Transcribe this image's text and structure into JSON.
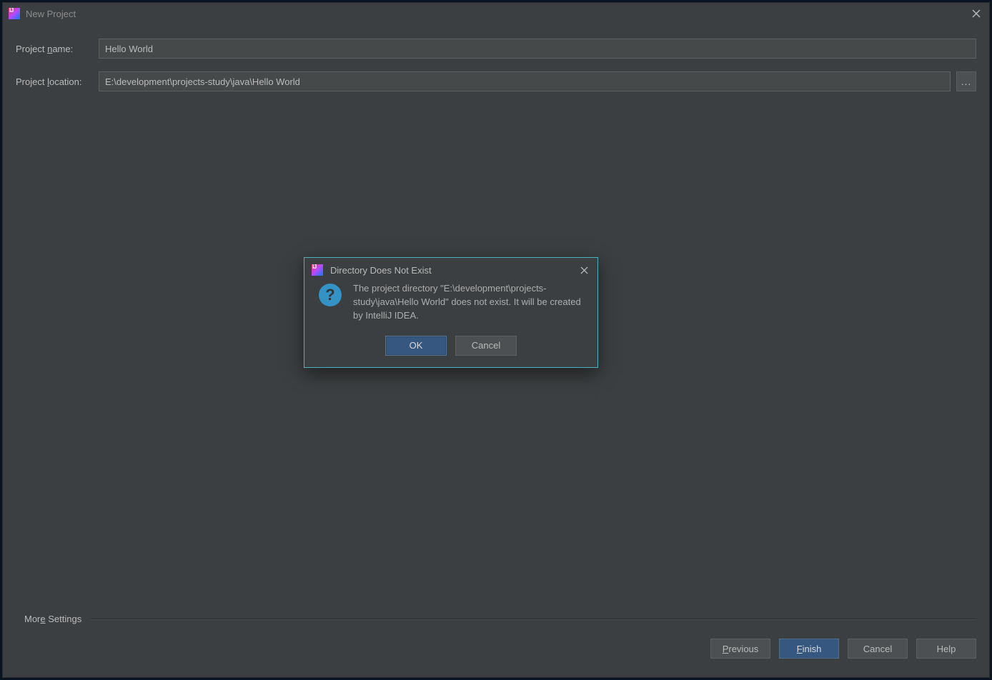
{
  "window": {
    "title": "New Project"
  },
  "form": {
    "project_name_label_pre": "Project ",
    "project_name_label_u": "n",
    "project_name_label_post": "ame:",
    "project_name_value": "Hello World",
    "project_location_label_pre": "Project ",
    "project_location_label_u": "l",
    "project_location_label_post": "ocation:",
    "project_location_value": "E:\\development\\projects-study\\java\\Hello World",
    "browse_label": "..."
  },
  "more_settings": {
    "label_pre": "Mor",
    "label_u": "e",
    "label_post": " Settings"
  },
  "footer": {
    "previous_pre": "",
    "previous_u": "P",
    "previous_post": "revious",
    "finish_pre": "",
    "finish_u": "F",
    "finish_post": "inish",
    "cancel": "Cancel",
    "help": "Help"
  },
  "modal": {
    "title": "Directory Does Not Exist",
    "message": "The project directory \"E:\\development\\projects-study\\java\\Hello World\" does not exist. It will be created by IntelliJ IDEA.",
    "ok": "OK",
    "cancel": "Cancel"
  }
}
